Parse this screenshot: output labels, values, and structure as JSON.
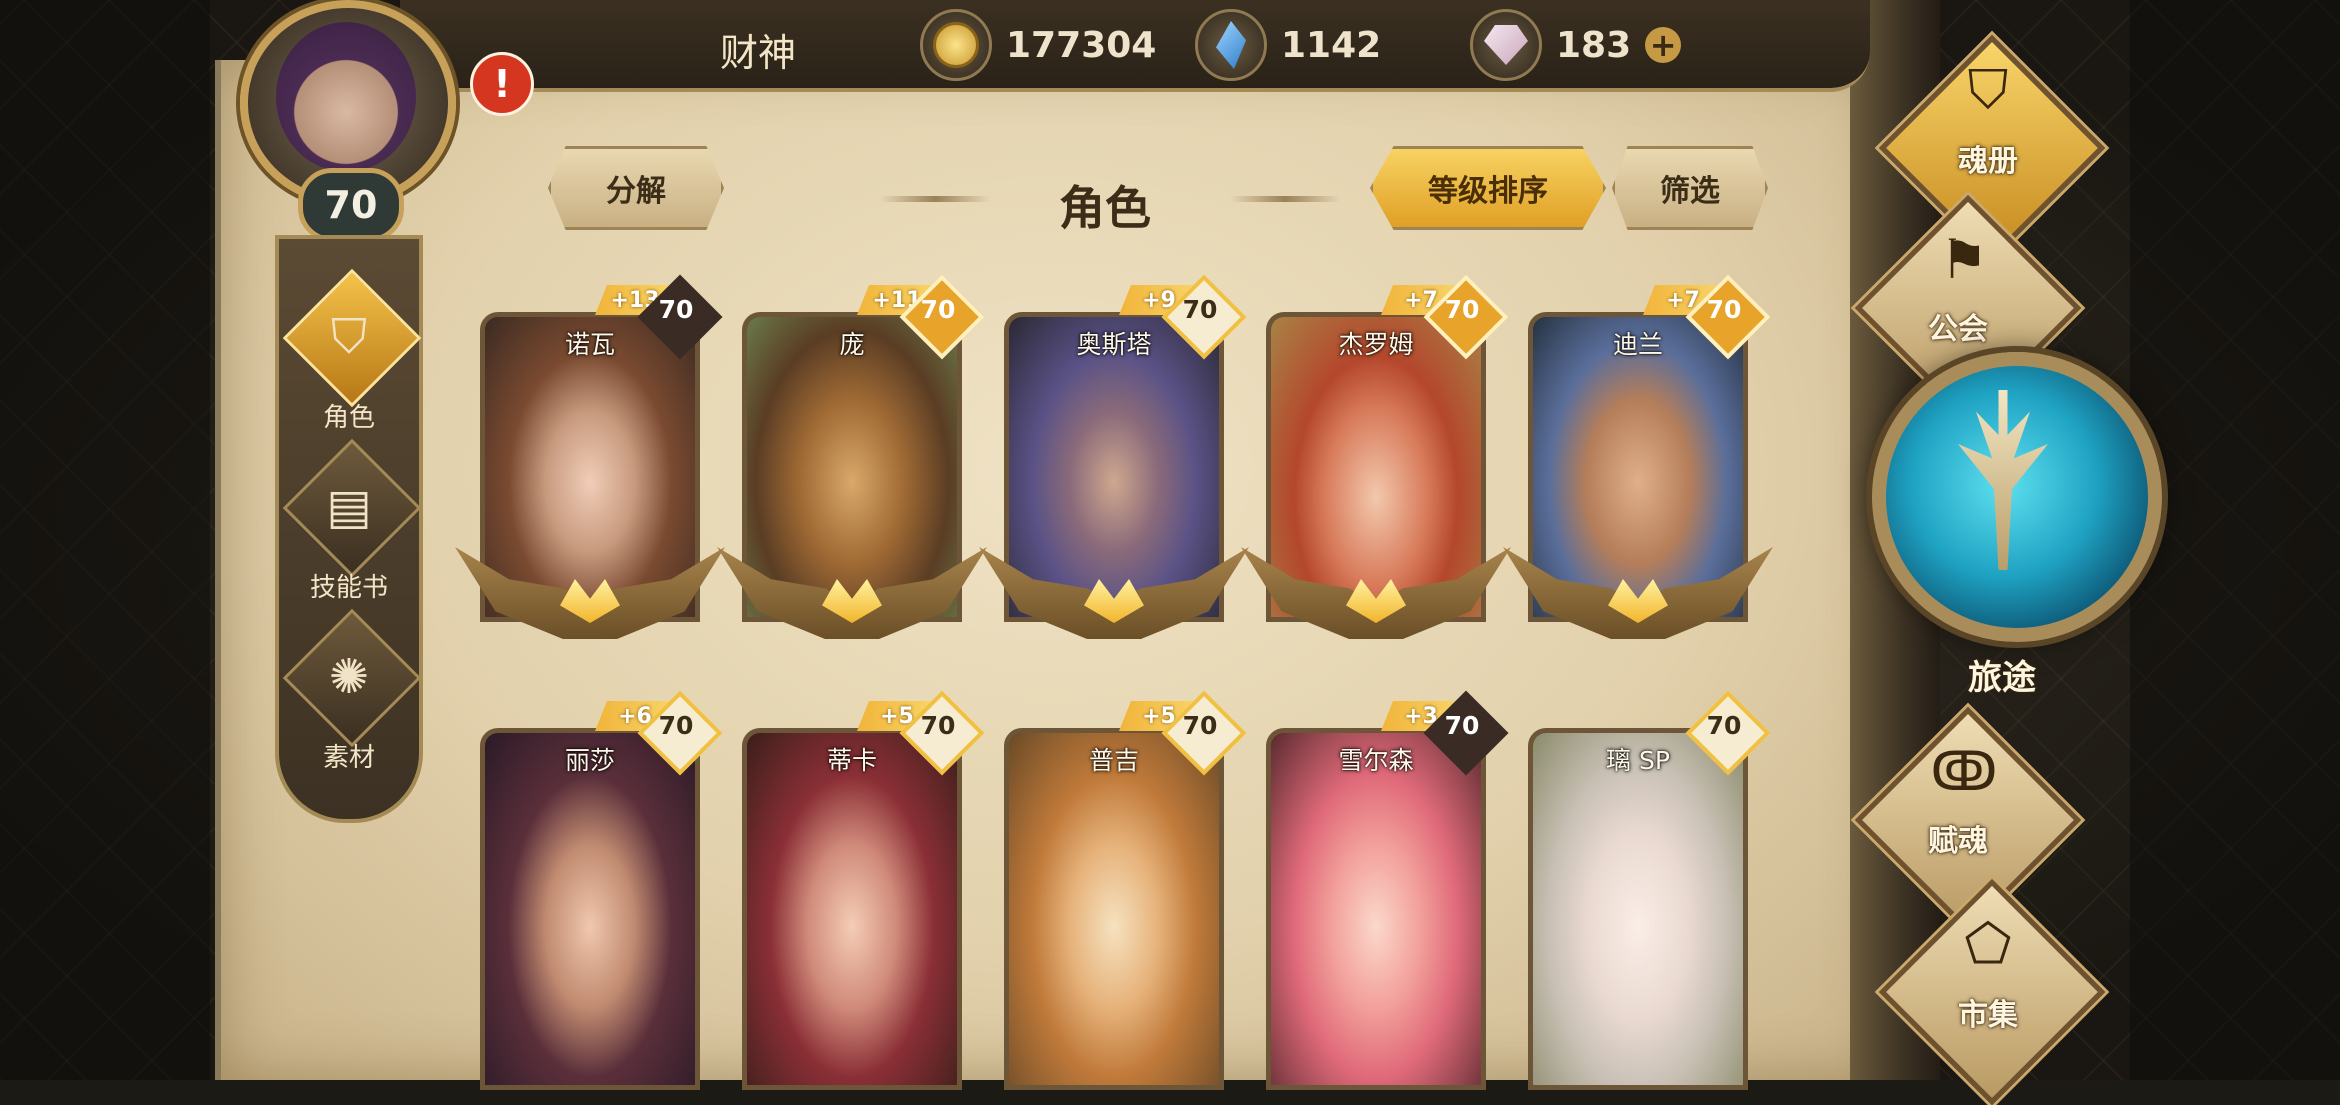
{
  "player": {
    "name": "财神",
    "level": "70",
    "alert": "!"
  },
  "currencies": {
    "gold": "177304",
    "crystal": "1142",
    "gem": "183",
    "gem_add": "+"
  },
  "left_menu": [
    {
      "label": "角色",
      "icon": "helmet-icon",
      "active": true
    },
    {
      "label": "技能书",
      "icon": "skillbook-icon",
      "active": false
    },
    {
      "label": "素材",
      "icon": "material-icon",
      "active": false
    }
  ],
  "header": {
    "decompose": "分解",
    "title": "角色",
    "sort": "等级排序",
    "filter": "筛选"
  },
  "characters": [
    {
      "name": "诺瓦",
      "bonus": "+13",
      "level": "70",
      "badge": "dark"
    },
    {
      "name": "庞",
      "bonus": "+11",
      "level": "70",
      "badge": "gold"
    },
    {
      "name": "奥斯塔",
      "bonus": "+9",
      "level": "70",
      "badge": "light"
    },
    {
      "name": "杰罗姆",
      "bonus": "+7",
      "level": "70",
      "badge": "gold"
    },
    {
      "name": "迪兰",
      "bonus": "+7",
      "level": "70",
      "badge": "gold"
    },
    {
      "name": "丽莎",
      "bonus": "+6",
      "level": "70",
      "badge": "light"
    },
    {
      "name": "蒂卡",
      "bonus": "+5",
      "level": "70",
      "badge": "light"
    },
    {
      "name": "普吉",
      "bonus": "+5",
      "level": "70",
      "badge": "light"
    },
    {
      "name": "雪尔森",
      "bonus": "+3",
      "level": "70",
      "badge": "dark"
    },
    {
      "name": "璃 SP",
      "bonus": "",
      "level": "70",
      "badge": "light"
    }
  ],
  "right_menu": {
    "soulbook": "魂册",
    "guild": "公会",
    "journey": "旅途",
    "endow": "赋魂",
    "market": "市集"
  }
}
